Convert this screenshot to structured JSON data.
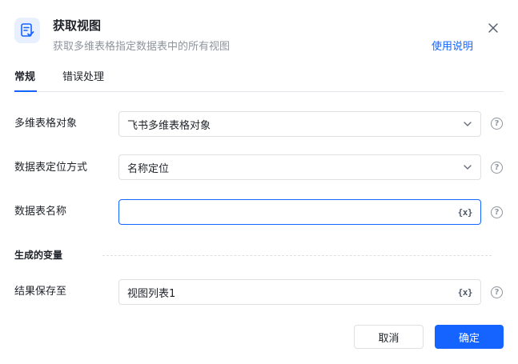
{
  "dialog": {
    "title": "获取视图",
    "subtitle": "获取多维表格指定数据表中的所有视图",
    "help_label": "使用说明",
    "accent_color": "#1664ff"
  },
  "tabs": [
    {
      "label": "常规",
      "active": true
    },
    {
      "label": "错误处理",
      "active": false
    }
  ],
  "fields": {
    "bitable_object": {
      "label": "多维表格对象",
      "value": "飞书多维表格对象",
      "kind": "select"
    },
    "locate_method": {
      "label": "数据表定位方式",
      "value": "名称定位",
      "kind": "select"
    },
    "table_name": {
      "label": "数据表名称",
      "value": "",
      "kind": "variable-input"
    }
  },
  "output": {
    "section_title": "生成的变量",
    "save_to": {
      "label": "结果保存至",
      "value": "视图列表1"
    }
  },
  "var_button_label": "{x}",
  "help_glyph": "?",
  "buttons": {
    "cancel": "取消",
    "ok": "确定"
  }
}
